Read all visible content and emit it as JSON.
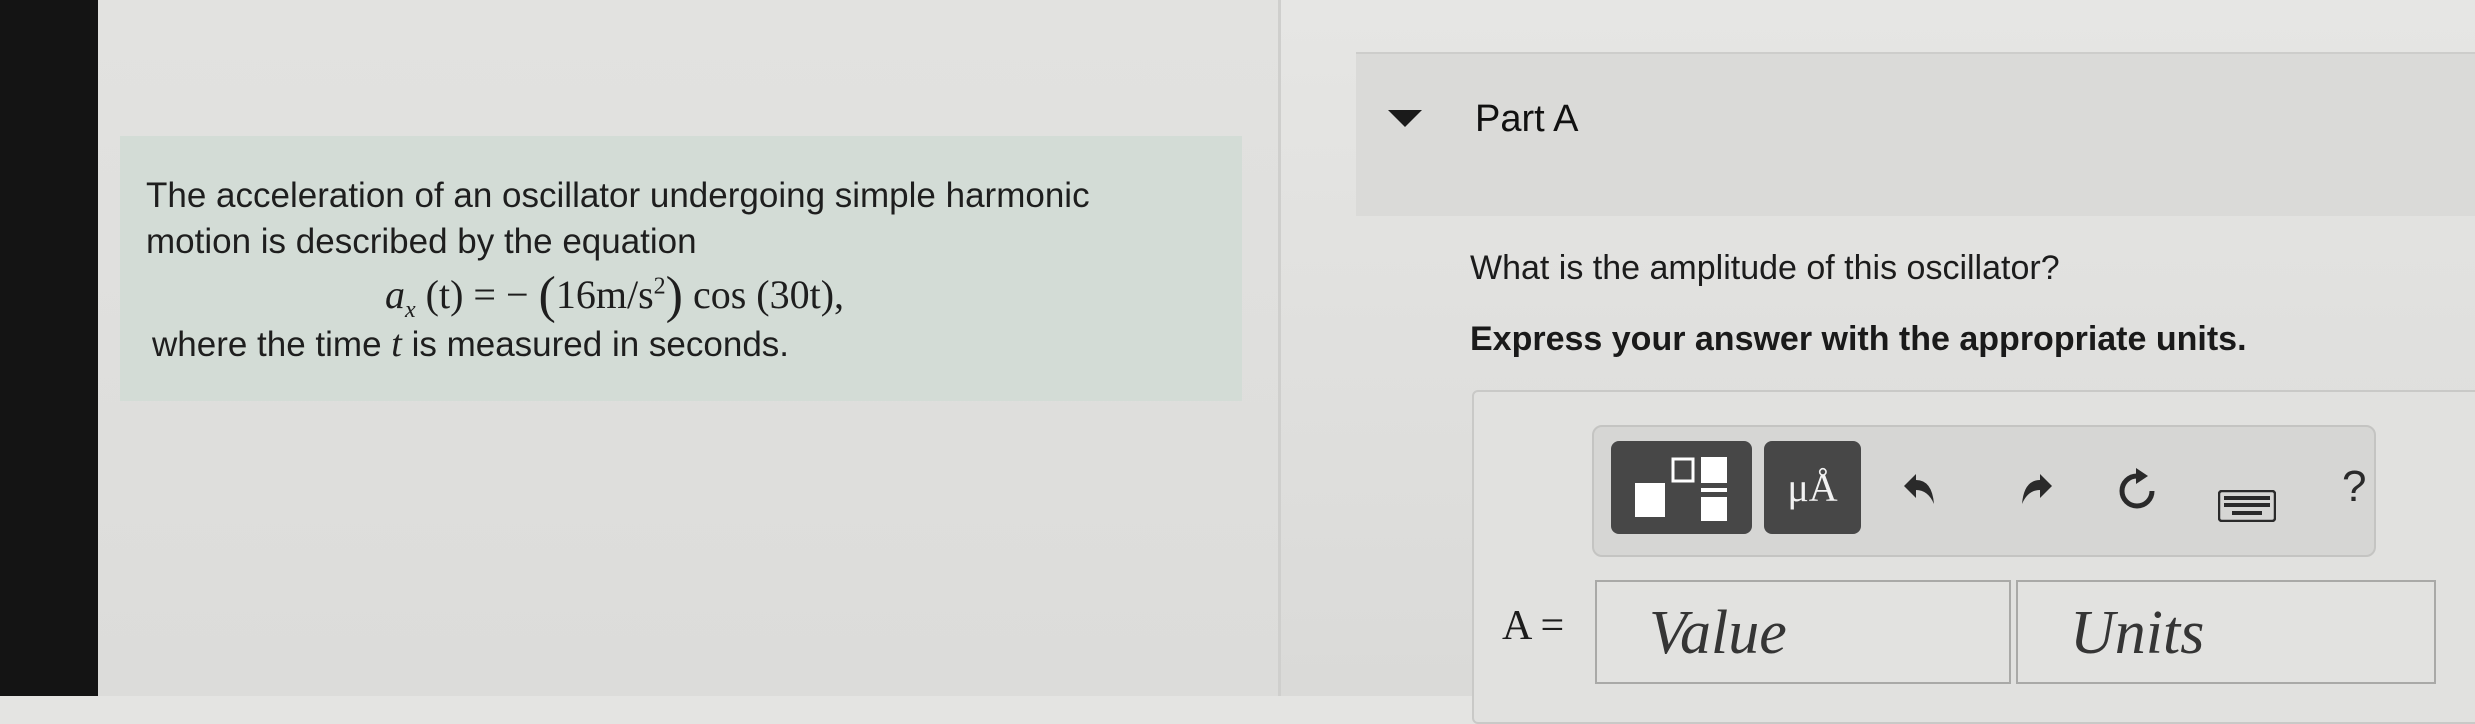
{
  "problem": {
    "line1": "The acceleration of an oscillator undergoing simple harmonic",
    "line2": "motion is described by the equation",
    "equation": {
      "lhs_var": "a",
      "lhs_sub": "x",
      "lhs_arg": "(t) = −",
      "coef": "16m/s",
      "exp": "2",
      "rhs": "cos (30t),"
    },
    "line3_before": "where the time",
    "line3_var": "t",
    "line3_after": "is measured in seconds."
  },
  "part": {
    "title": "Part A",
    "question": "What is the amplitude of this oscillator?",
    "instruction": "Express your answer with the appropriate units."
  },
  "toolbar": {
    "units_label": "μÅ",
    "help_label": "?",
    "icons": [
      "templates-icon",
      "units-icon",
      "undo-icon",
      "redo-icon",
      "reset-icon",
      "keyboard-icon",
      "help-icon"
    ]
  },
  "answer": {
    "label": "A =",
    "value_placeholder": "Value",
    "units_placeholder": "Units"
  }
}
